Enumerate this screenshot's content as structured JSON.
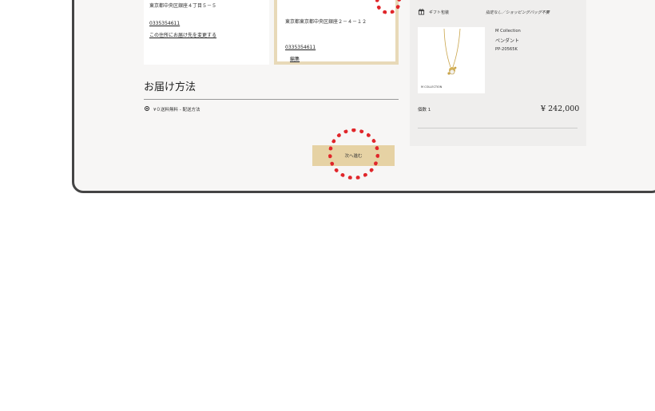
{
  "address_a": {
    "address": "東京都中央区銀座４丁目５－５",
    "phone": "0335354611",
    "change_link": "この住所にお届け先を変更する"
  },
  "address_b": {
    "address": "東京都東京都中央区銀座２－４－１２",
    "phone": "0335354611",
    "edit_link": "編集"
  },
  "delivery": {
    "heading": "お届け方法",
    "option_label": "¥０送料無料 - 配送方法",
    "next_button": "次へ進む"
  },
  "summary": {
    "gift_label": "ギフト包装",
    "gift_value": "指定なし／ショッピングバッグ不要",
    "product": {
      "brand": "M Collection",
      "name": "ペンダント",
      "sku": "PP-20565K",
      "image_caption": "M COLLECTION"
    },
    "quantity": "個数 1",
    "price": "¥ 242,000"
  },
  "colors": {
    "accent_gold": "#e6d2a4",
    "selected_border": "#e8d9b8",
    "highlight_ring": "#e0262a"
  }
}
